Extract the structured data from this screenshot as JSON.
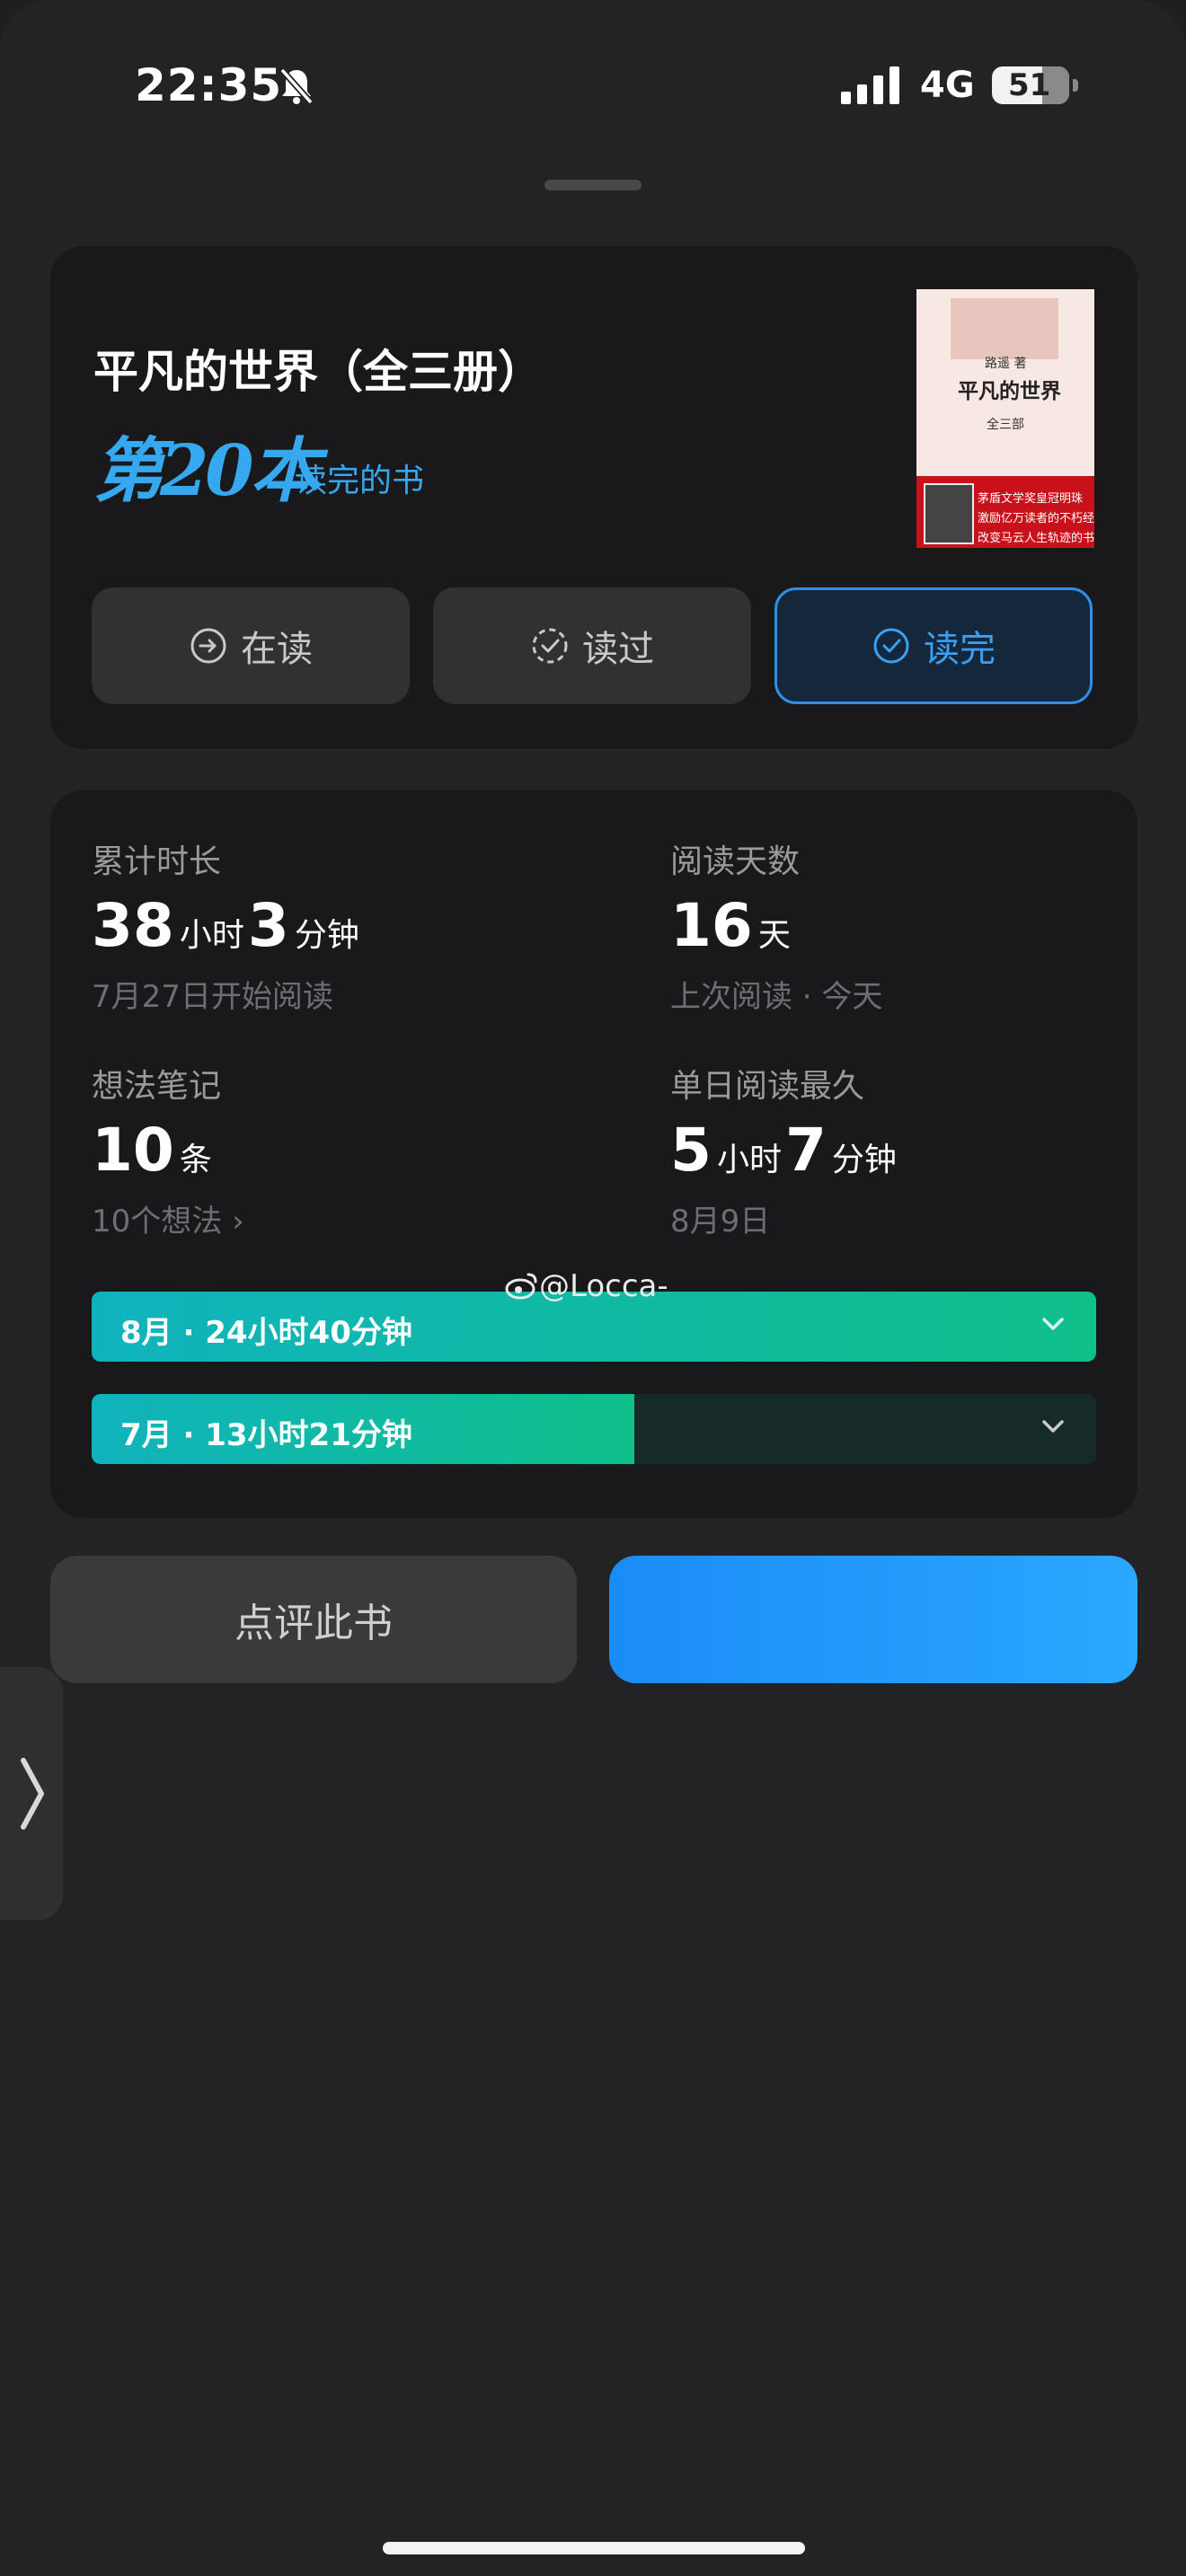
{
  "status": {
    "time": "22:35",
    "network": "4G",
    "battery": "51"
  },
  "book": {
    "title": "平凡的世界（全三册）",
    "rank": "第20本",
    "rank_suffix": "读完的书",
    "cover": {
      "author": "路遥 著",
      "title": "平凡的世界",
      "subtitle": "全三部",
      "band_lines": [
        "茅盾文学奖皇冠明珠",
        "激励亿万读者的不朽经典",
        "改变马云人生轨迹的书"
      ]
    }
  },
  "status_tabs": [
    {
      "label": "在读",
      "icon": "arrow-circle-icon",
      "active": false
    },
    {
      "label": "读过",
      "icon": "dashed-check-circle-icon",
      "active": false
    },
    {
      "label": "读完",
      "icon": "check-circle-icon",
      "active": true
    }
  ],
  "stats": {
    "total_time": {
      "label": "累计时长",
      "hours": "38",
      "hours_unit": "小时",
      "minutes": "3",
      "minutes_unit": "分钟",
      "sub": "7月27日开始阅读"
    },
    "days": {
      "label": "阅读天数",
      "value": "16",
      "unit": "天",
      "sub": "上次阅读 · 今天"
    },
    "notes": {
      "label": "想法笔记",
      "value": "10",
      "unit": "条",
      "sub": "10个想法 ›"
    },
    "longest_day": {
      "label": "单日阅读最久",
      "hours": "5",
      "hours_unit": "小时",
      "minutes": "7",
      "minutes_unit": "分钟",
      "sub": "8月9日"
    }
  },
  "months": [
    {
      "label": "8月 · 24小时40分钟",
      "fraction": 1.0
    },
    {
      "label": "7月 · 13小时21分钟",
      "fraction": 0.54
    }
  ],
  "watermark": "@Locca-",
  "actions": {
    "review": "点评此书"
  },
  "colors": {
    "accent": "#35a8f0",
    "bar_start": "#10b3bd",
    "bar_end": "#0fc08a",
    "primary_button": "#1a8cf6"
  }
}
